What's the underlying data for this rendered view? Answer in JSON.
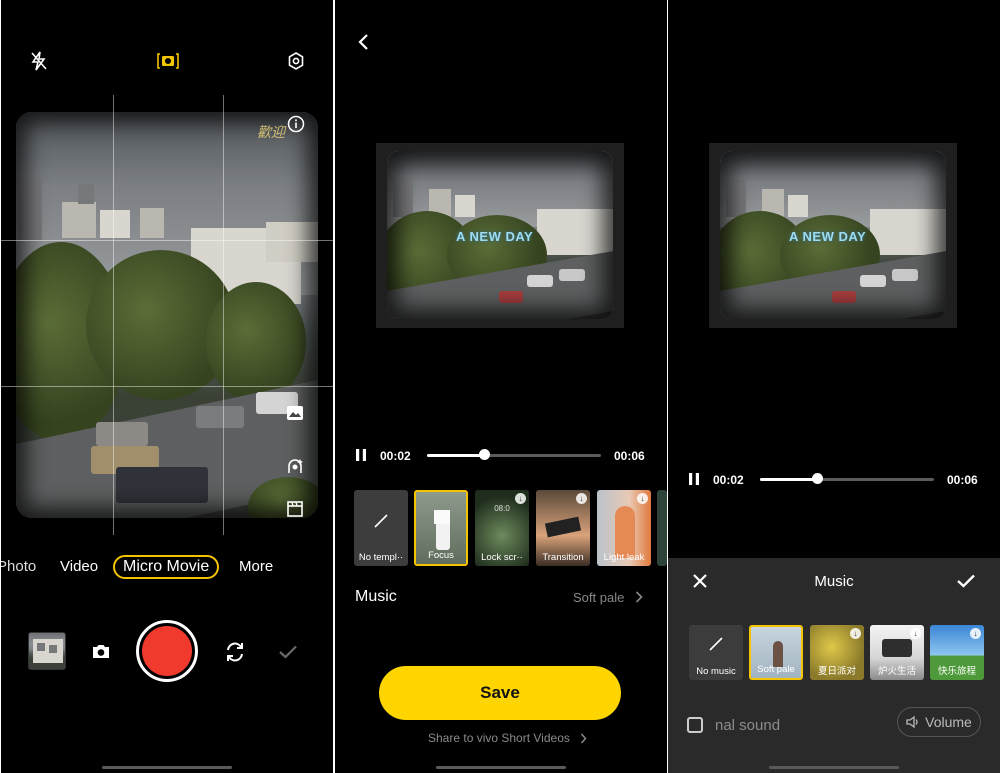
{
  "panel1": {
    "modes": [
      "Photo",
      "Video",
      "Micro Movie",
      "More"
    ],
    "active_mode": "Micro Movie",
    "icons": {
      "flash": "flash-off-icon",
      "camera_mode": "camera-frame-icon",
      "settings": "settings-icon",
      "info": "info-icon",
      "side1": "frame-icon",
      "side2": "filter-icon",
      "side3": "clapper-icon",
      "photo_switch": "camera-icon",
      "switch": "switch-camera-icon",
      "confirm": "check-icon"
    },
    "watermark": "歡迎"
  },
  "panel2": {
    "overlay_text": "A NEW DAY",
    "time_current": "00:02",
    "time_total": "00:06",
    "progress": 0.33,
    "templates": [
      {
        "label": "No templ··",
        "selected": false
      },
      {
        "label": "Focus",
        "selected": true
      },
      {
        "label": "Lock scr··",
        "selected": false
      },
      {
        "label": "Transition",
        "selected": false
      },
      {
        "label": "Light leak",
        "selected": false
      }
    ],
    "template_top_text": "08:0",
    "music_label": "Music",
    "music_value": "Soft pale",
    "save_label": "Save",
    "share_label": "Share to vivo Short Videos"
  },
  "panel3": {
    "overlay_text": "A NEW DAY",
    "time_current": "00:02",
    "time_total": "00:06",
    "progress": 0.33,
    "sheet_title": "Music",
    "music_items": [
      {
        "label": "No music",
        "selected": false
      },
      {
        "label": "Soft pale",
        "selected": true
      },
      {
        "label": "夏日派对",
        "selected": false
      },
      {
        "label": "炉火生活",
        "selected": false
      },
      {
        "label": "快乐旅程",
        "selected": false
      }
    ],
    "original_sound_label": "nal sound",
    "volume_label": "Volume"
  },
  "colors": {
    "accent": "#f5c400",
    "save": "#ffd500",
    "shutter": "#f03a2e",
    "sheet": "#2a2a2a"
  }
}
